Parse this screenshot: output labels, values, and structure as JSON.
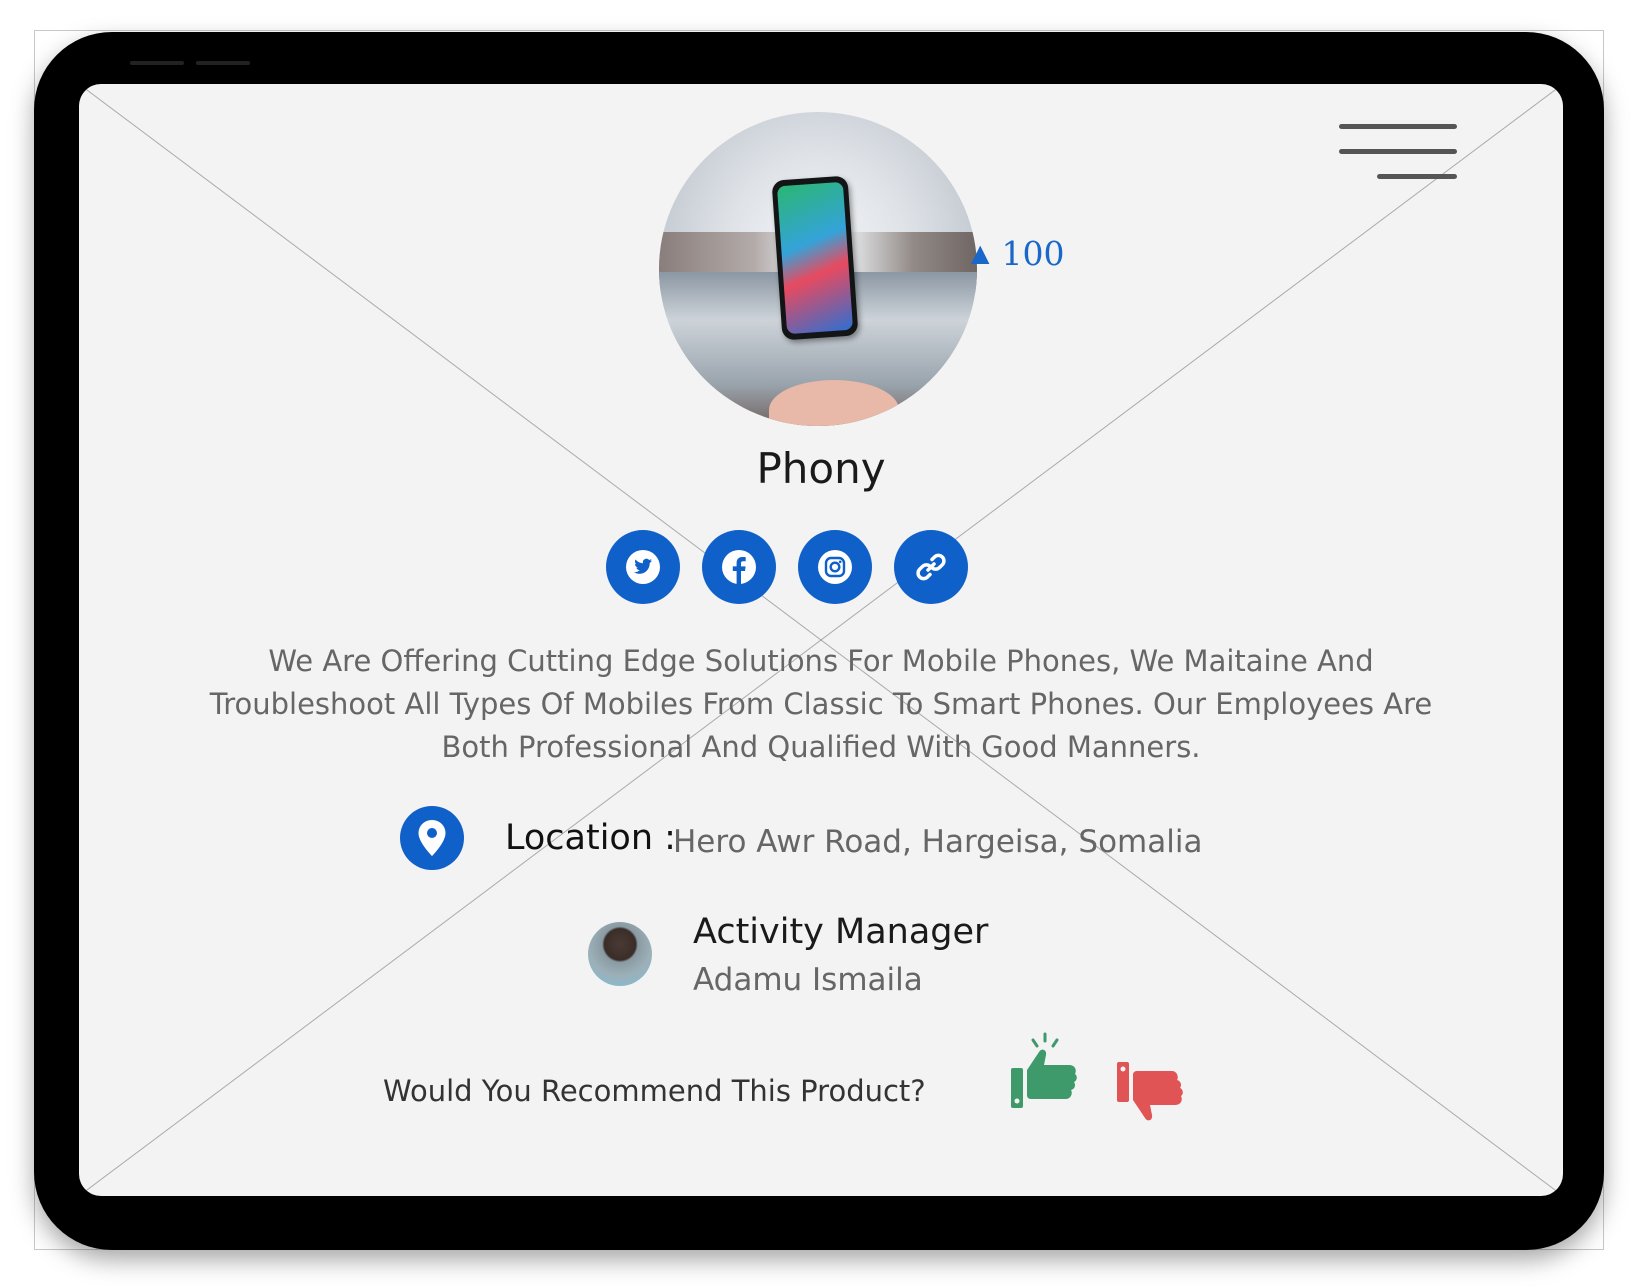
{
  "header": {
    "menu_icon": "hamburger-menu-icon"
  },
  "product": {
    "name": "Phony",
    "upvote_arrow": "▲",
    "upvotes": "100",
    "image_icon": "product-photo-phone"
  },
  "social_links": [
    {
      "name": "twitter",
      "icon": "twitter-icon"
    },
    {
      "name": "facebook",
      "icon": "facebook-icon"
    },
    {
      "name": "instagram",
      "icon": "instagram-icon"
    },
    {
      "name": "link",
      "icon": "link-icon"
    }
  ],
  "description": "We Are Offering Cutting Edge Solutions For Mobile Phones, We Maitaine And Troubleshoot All Types Of Mobiles From Classic To Smart Phones. Our Employees Are Both Professional And Qualified With Good Manners.",
  "location": {
    "label": "Location :",
    "value": "Hero Awr Road, Hargeisa, Somalia",
    "icon": "map-pin-icon"
  },
  "manager": {
    "title": "Activity Manager",
    "name": "Adamu Ismaila"
  },
  "recommend": {
    "question": "Would You Recommend This Product?",
    "yes_icon": "thumbs-up-icon",
    "no_icon": "thumbs-down-icon"
  },
  "colors": {
    "accent": "#0f60c8",
    "thumb_up": "#3f9a6b",
    "thumb_down": "#e05455",
    "background": "#f3f3f3"
  }
}
